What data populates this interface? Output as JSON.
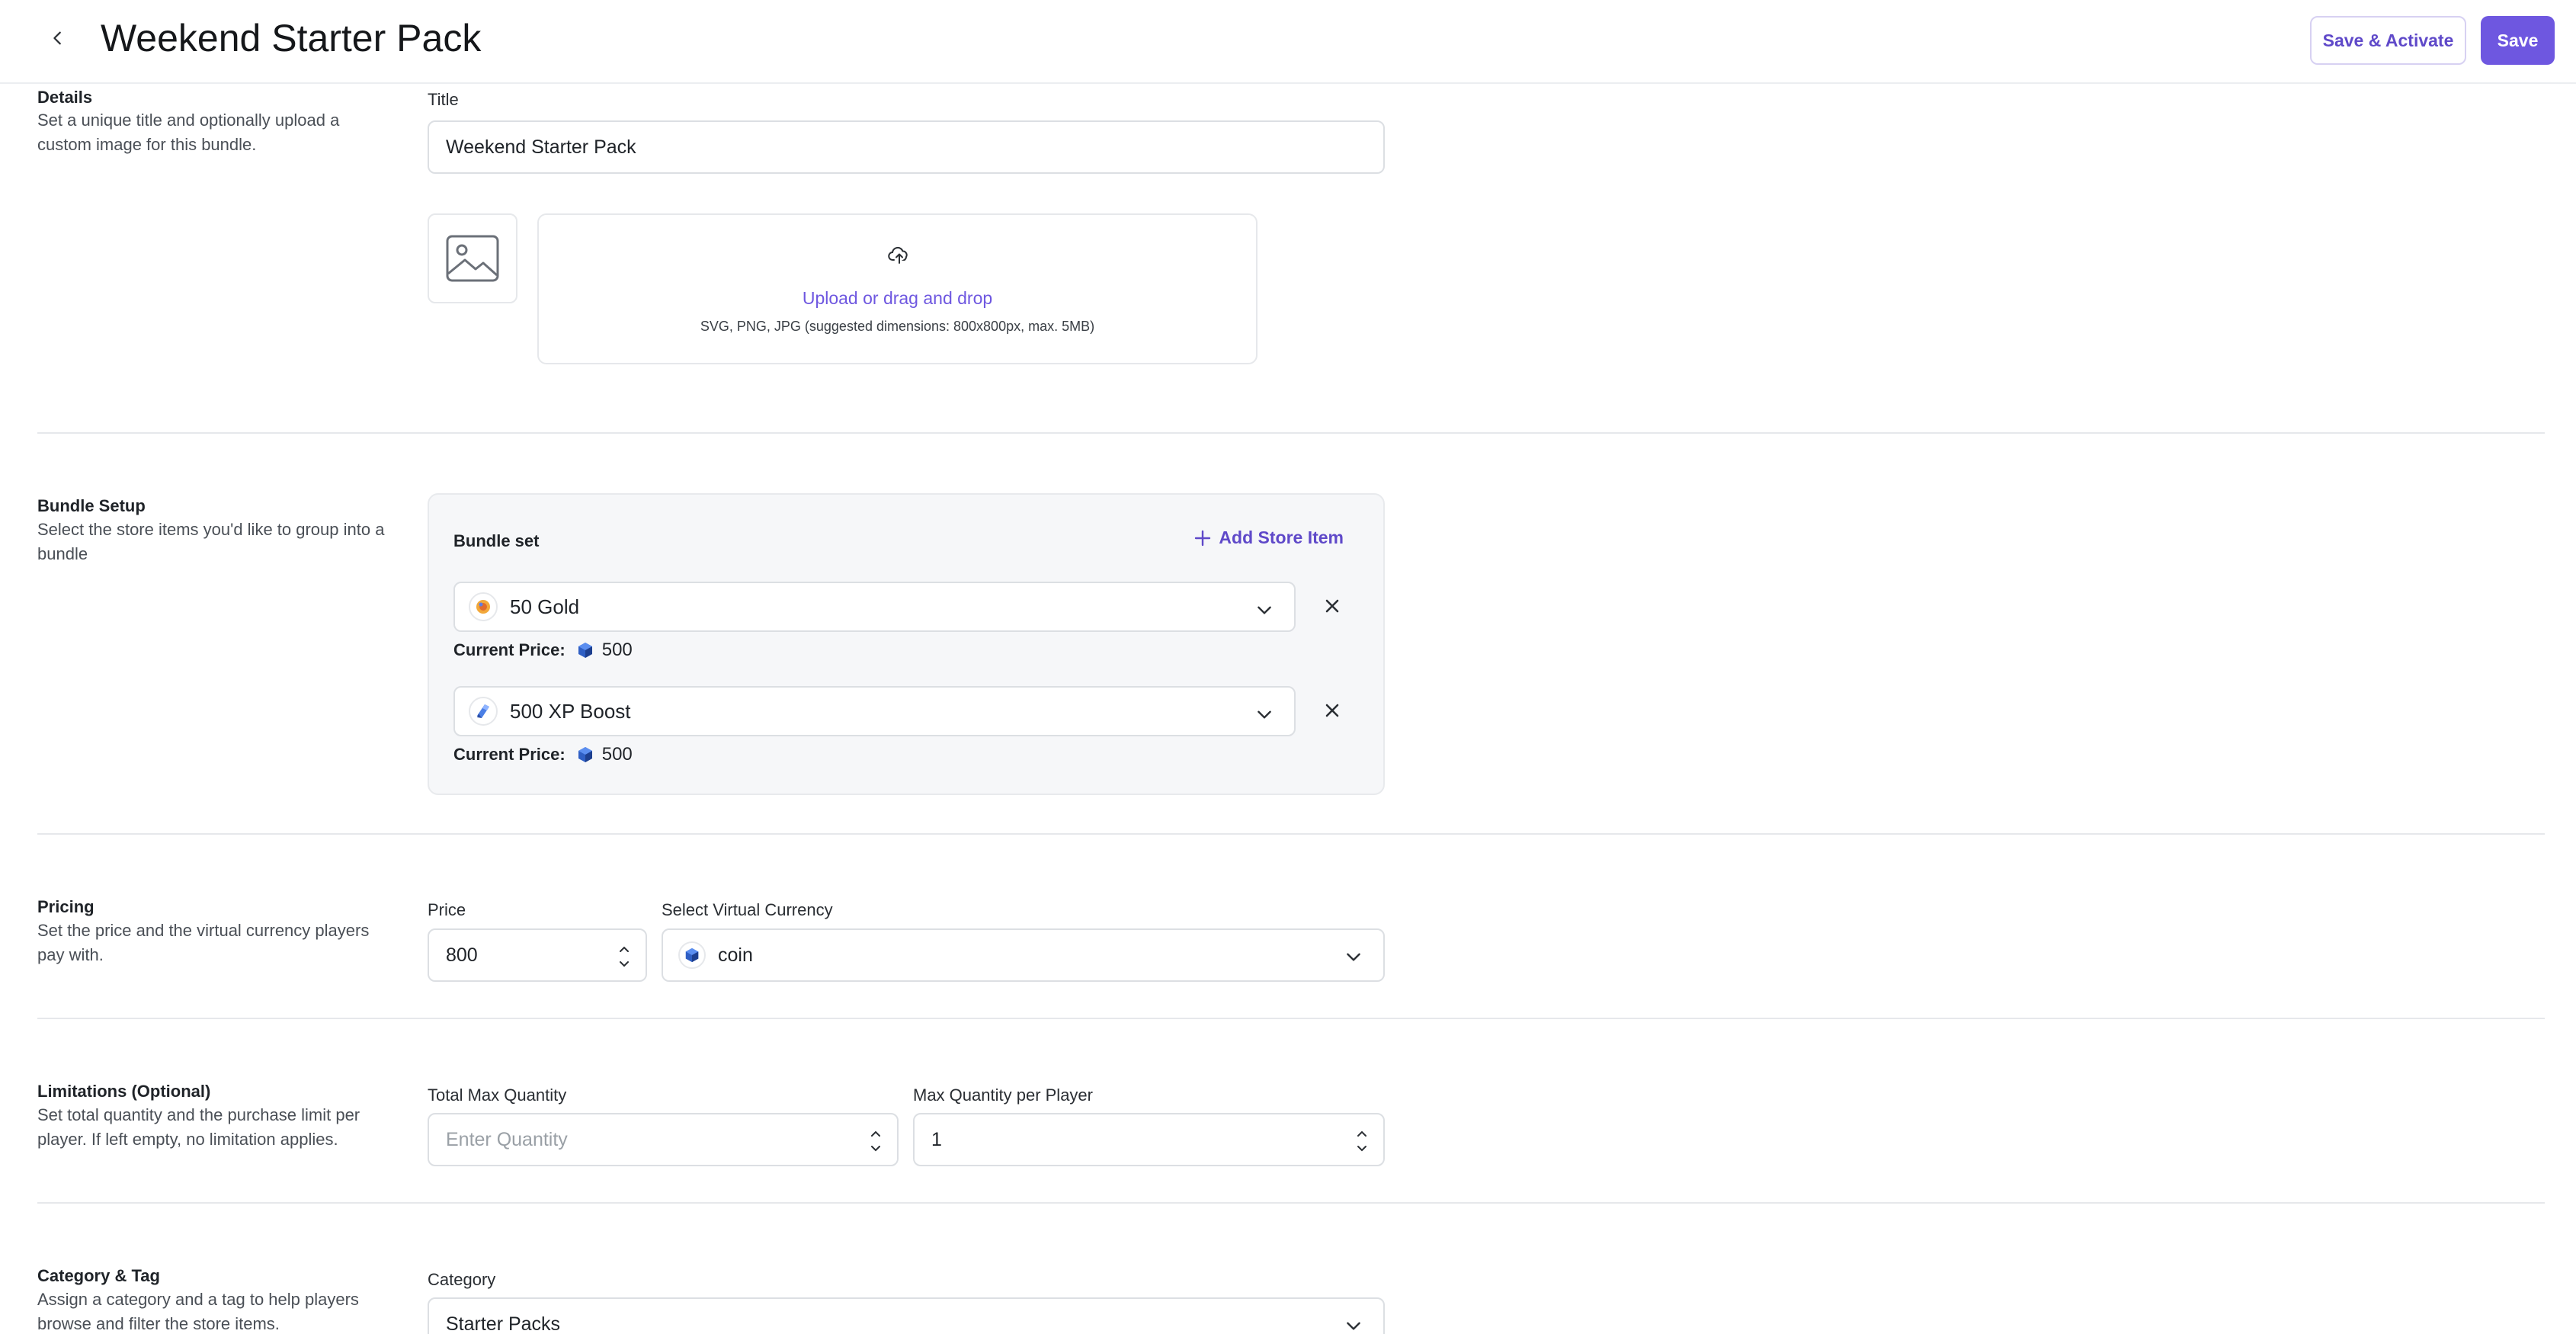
{
  "header": {
    "title": "Weekend Starter Pack",
    "save_activate_label": "Save & Activate",
    "save_label": "Save"
  },
  "details": {
    "title": "Details",
    "description": "Set a unique title and optionally upload a custom image for this bundle.",
    "title_label": "Title",
    "title_value": "Weekend Starter Pack",
    "upload_link": "Upload or drag and drop",
    "upload_hint": "SVG, PNG, JPG (suggested dimensions: 800x800px, max. 5MB)"
  },
  "bundle": {
    "title": "Bundle Setup",
    "description": "Select the store items you'd like to group into a bundle",
    "set_label": "Bundle set",
    "add_label": "Add Store Item",
    "items": [
      {
        "name": "50 Gold",
        "price_label": "Current Price:",
        "price": "500"
      },
      {
        "name": "500 XP Boost",
        "price_label": "Current Price:",
        "price": "500"
      }
    ]
  },
  "pricing": {
    "title": "Pricing",
    "description": "Set the price and the virtual currency players pay with.",
    "price_label": "Price",
    "price_value": "800",
    "currency_label": "Select Virtual Currency",
    "currency_value": "coin"
  },
  "limits": {
    "title": "Limitations (Optional)",
    "description": "Set total quantity and the purchase limit per player. If left empty, no limitation applies.",
    "total_label": "Total Max Quantity",
    "total_placeholder": "Enter Quantity",
    "per_player_label": "Max Quantity per Player",
    "per_player_value": "1"
  },
  "category": {
    "title": "Category & Tag",
    "description": "Assign a category and a tag to help players browse and filter the store items.",
    "category_label": "Category",
    "category_value": "Starter Packs"
  },
  "colors": {
    "accent": "#6e57e0",
    "accent_text": "#5f49c9"
  }
}
